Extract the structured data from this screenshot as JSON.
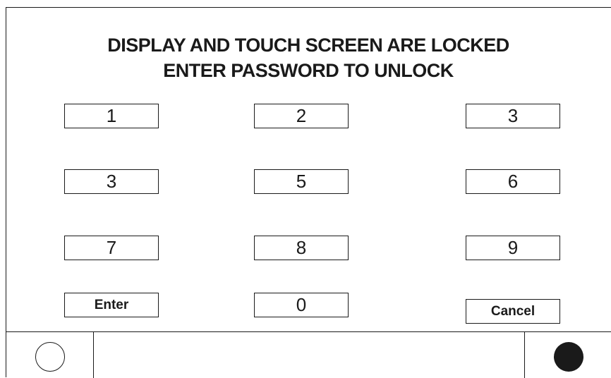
{
  "header": {
    "line1": "DISPLAY AND TOUCH SCREEN ARE LOCKED",
    "line2": "ENTER PASSWORD TO UNLOCK"
  },
  "keypad": {
    "k_r1c1": "1",
    "k_r1c2": "2",
    "k_r1c3": "3",
    "k_r2c1": "3",
    "k_r2c2": "5",
    "k_r2c3": "6",
    "k_r3c1": "7",
    "k_r3c2": "8",
    "k_r3c3": "9",
    "enter_label": "Enter",
    "k_r4c2": "0",
    "cancel_label": "Cancel"
  },
  "footer": {
    "left_indicator": "open-circle-icon",
    "right_indicator": "filled-circle-icon"
  },
  "colors": {
    "foreground": "#1a1a1a",
    "background": "#ffffff"
  }
}
